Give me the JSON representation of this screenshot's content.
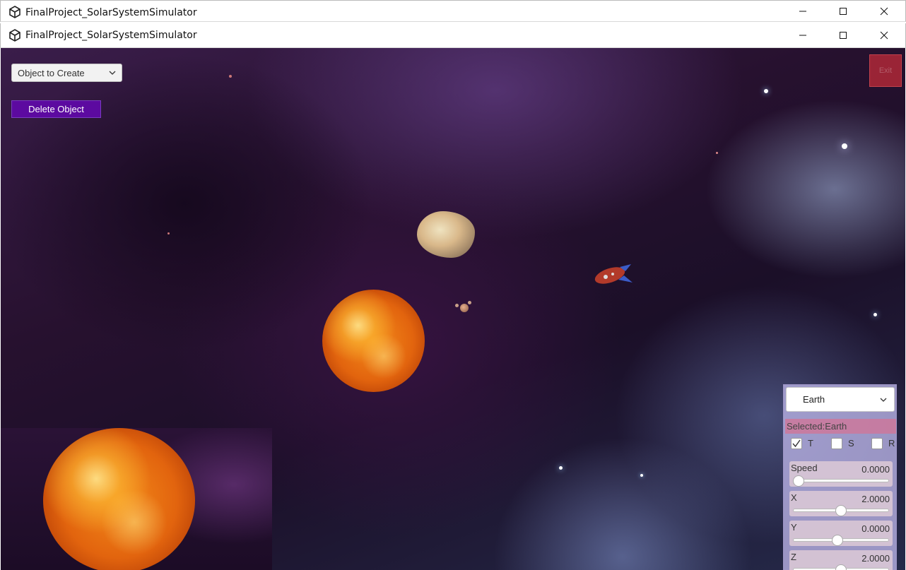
{
  "window": {
    "title_outer": "FinalProject_SolarSystemSimulator",
    "title_inner": "FinalProject_SolarSystemSimulator"
  },
  "controls": {
    "create_dropdown_label": "Object to Create",
    "delete_button_label": "Delete Object",
    "exit_button_label": "Exit"
  },
  "panel": {
    "selected_object": "Earth",
    "selected_text": "Selected:Earth",
    "toggles": [
      {
        "label": "T",
        "checked": true
      },
      {
        "label": "S",
        "checked": false
      },
      {
        "label": "R",
        "checked": false
      }
    ],
    "sliders": [
      {
        "label": "Speed",
        "value": "0.0000",
        "fraction": 0.0
      },
      {
        "label": "X",
        "value": "2.0000",
        "fraction": 0.5
      },
      {
        "label": "Y",
        "value": "0.0000",
        "fraction": 0.46
      },
      {
        "label": "Z",
        "value": "2.0000",
        "fraction": 0.5
      }
    ]
  },
  "colors": {
    "delete_button": "#5c0aa0",
    "exit_button": "#af2837",
    "selected_bar": "#cd789b"
  }
}
